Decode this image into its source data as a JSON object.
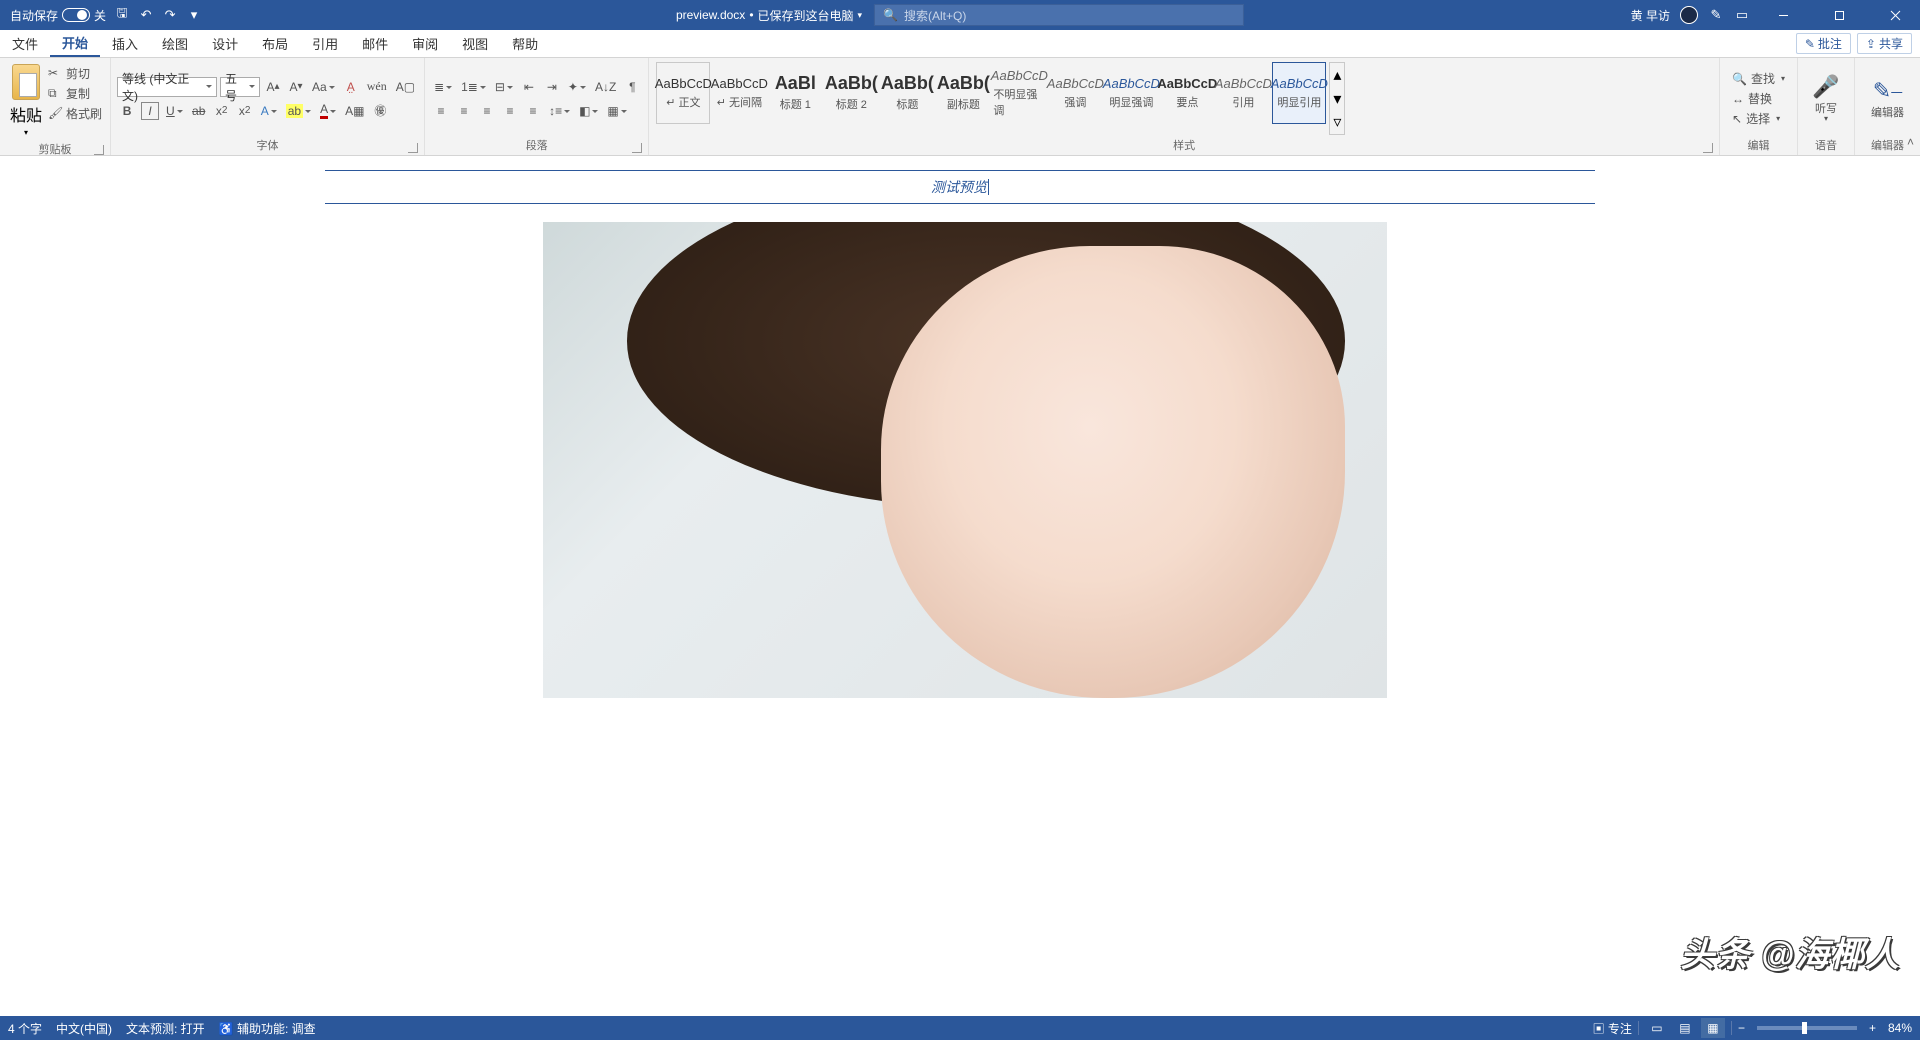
{
  "titlebar": {
    "autosave_label": "自动保存",
    "autosave_state": "关",
    "doc_name": "preview.docx",
    "doc_status": "已保存到这台电脑",
    "search_placeholder": "搜索(Alt+Q)",
    "user_name": "黄 早访"
  },
  "menus": [
    "文件",
    "开始",
    "插入",
    "绘图",
    "设计",
    "布局",
    "引用",
    "邮件",
    "审阅",
    "视图",
    "帮助"
  ],
  "menubar_right": {
    "comments": "批注",
    "share": "共享"
  },
  "ribbon": {
    "clipboard": {
      "paste": "粘贴",
      "cut": "剪切",
      "copy": "复制",
      "format_painter": "格式刷",
      "label": "剪贴板"
    },
    "font": {
      "font_name": "等线 (中文正文)",
      "font_size": "五号",
      "label": "字体"
    },
    "paragraph": {
      "label": "段落"
    },
    "styles": {
      "label": "样式",
      "items": [
        {
          "preview": "AaBbCcD",
          "name": "正文",
          "cls": ""
        },
        {
          "preview": "AaBbCcD",
          "name": "无间隔",
          "cls": ""
        },
        {
          "preview": "AaBl",
          "name": "标题 1",
          "cls": "big"
        },
        {
          "preview": "AaBb(",
          "name": "标题 2",
          "cls": "big"
        },
        {
          "preview": "AaBb(",
          "name": "标题",
          "cls": "big"
        },
        {
          "preview": "AaBb(",
          "name": "副标题",
          "cls": "big"
        },
        {
          "preview": "AaBbCcD",
          "name": "不明显强调",
          "cls": "greyital"
        },
        {
          "preview": "AaBbCcD",
          "name": "强调",
          "cls": "greyital"
        },
        {
          "preview": "AaBbCcD",
          "name": "明显强调",
          "cls": "blueital"
        },
        {
          "preview": "AaBbCcD",
          "name": "要点",
          "cls": "bold"
        },
        {
          "preview": "AaBbCcD",
          "name": "引用",
          "cls": "greyital"
        },
        {
          "preview": "AaBbCcD",
          "name": "明显引用",
          "cls": "blueital"
        }
      ]
    },
    "editing": {
      "find": "查找",
      "replace": "替换",
      "select": "选择",
      "label": "编辑"
    },
    "voice": {
      "label": "听写",
      "group": "语音"
    },
    "editor": {
      "label": "编辑器",
      "group": "编辑器"
    }
  },
  "document": {
    "title_text": "测试预览",
    "watermark": "头条 @海椰人"
  },
  "statusbar": {
    "word_count": "4 个字",
    "language": "中文(中国)",
    "text_predict": "文本预测: 打开",
    "accessibility": "辅助功能: 调查",
    "focus": "专注",
    "zoom": "84%",
    "zoom_minus": "−",
    "zoom_plus": "+"
  }
}
